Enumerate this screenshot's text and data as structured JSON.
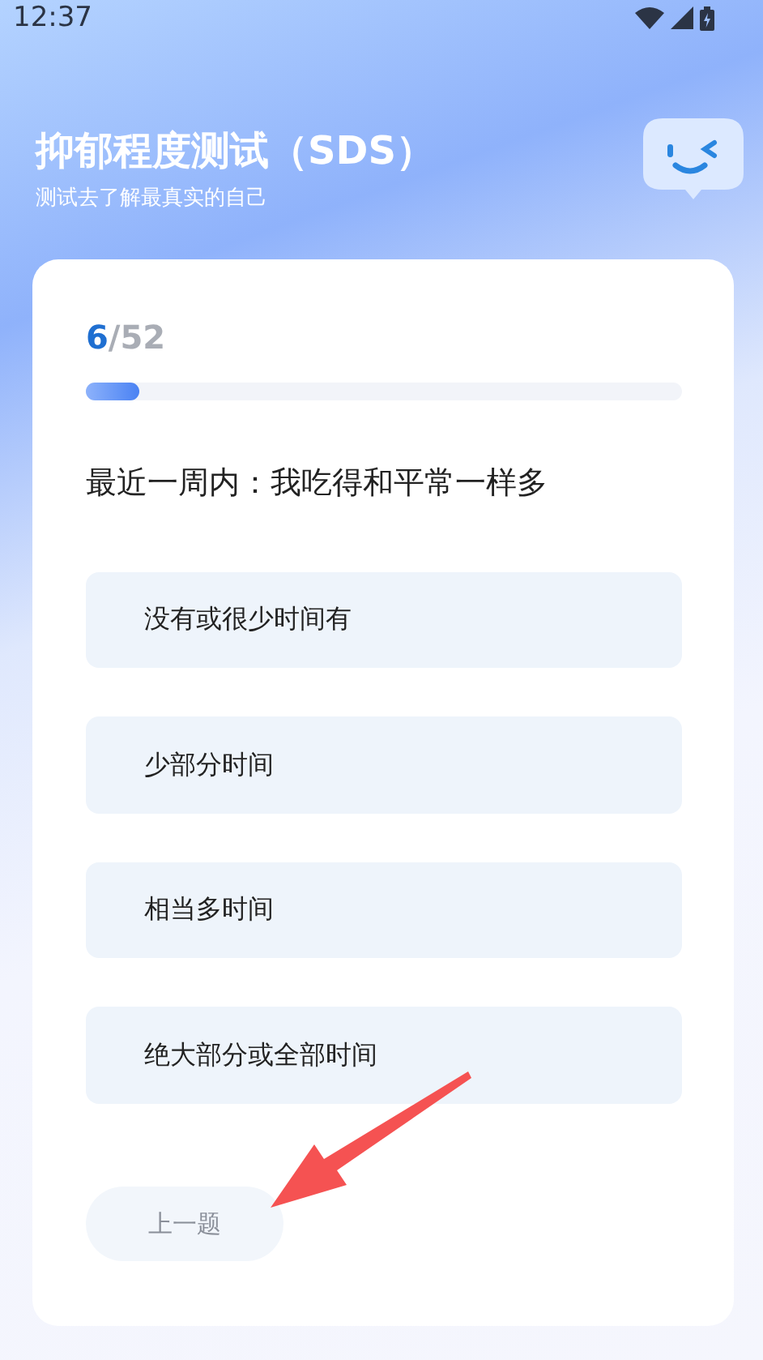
{
  "status_bar": {
    "time": "12:37"
  },
  "header": {
    "title": "抑郁程度测试（SDS）",
    "subtitle": "测试去了解最真实的自己"
  },
  "progress": {
    "current": "6",
    "total": "/52",
    "level": 0.09
  },
  "question": "最近一周内：我吃得和平常一样多",
  "options": [
    {
      "label": "没有或很少时间有",
      "selected": false
    },
    {
      "label": "少部分时间",
      "selected": false
    },
    {
      "label": "相当多时间",
      "selected": false
    },
    {
      "label": "绝大部分或全部时间",
      "selected": false
    }
  ],
  "back_button": "上一题"
}
